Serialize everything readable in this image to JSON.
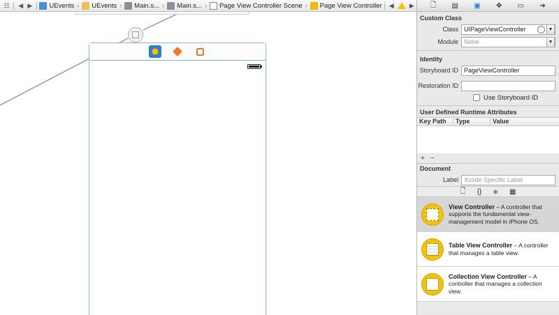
{
  "jumpbar": {
    "crumbs": [
      "UEvents",
      "UEvents",
      "Main.s...",
      "Main.s...",
      "Page View Controller Scene",
      "Page View Controller"
    ]
  },
  "inspector": {
    "custom_class": {
      "title": "Custom Class",
      "class_label": "Class",
      "class_value": "UIPageViewController",
      "module_label": "Module",
      "module_placeholder": "None"
    },
    "identity": {
      "title": "Identity",
      "storyboard_id_label": "Storyboard ID",
      "storyboard_id_value": "PageViewController",
      "restoration_id_label": "Restoration ID",
      "restoration_id_value": "",
      "use_storyboard_id_label": "Use Storyboard ID"
    },
    "runtime_attributes": {
      "title": "User Defined Runtime Attributes",
      "columns": [
        "Key Path",
        "Type",
        "Value"
      ],
      "add": "+",
      "remove": "−"
    },
    "document": {
      "title": "Document",
      "label_label": "Label",
      "label_placeholder": "Xcode Specific Label"
    }
  },
  "library": {
    "items": [
      {
        "name": "View Controller",
        "desc": " – A controller that supports the fundamental view-management model in iPhone OS."
      },
      {
        "name": "Table View Controller",
        "desc": " – A controller that manages a table view."
      },
      {
        "name": "Collection View Controller",
        "desc": " – A controller that manages a collection view."
      }
    ]
  },
  "colors": {
    "accent": "#2a7ae2",
    "scene_border": "#7fb6e6",
    "library_icon": "#f4c20d"
  }
}
